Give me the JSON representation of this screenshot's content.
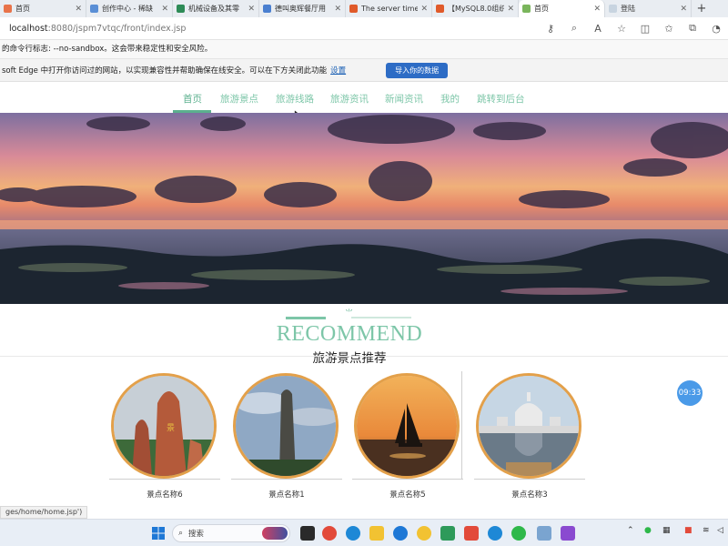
{
  "browser": {
    "tabs": [
      {
        "label": "首页",
        "favicon_color": "#e8734a",
        "active": false
      },
      {
        "label": "创作中心 - 稀缺",
        "favicon_color": "#5a8fd6",
        "active": false
      },
      {
        "label": "机械设备及其零",
        "favicon_color": "#2e8b57",
        "active": false
      },
      {
        "label": "德叫奥辉餐厅用",
        "favicon_color": "#4a7fd0",
        "active": false
      },
      {
        "label": "The server time",
        "favicon_color": "#e05a2a",
        "active": false
      },
      {
        "label": "【MySQL8.0组织",
        "favicon_color": "#e05a2a",
        "active": false
      },
      {
        "label": "首页",
        "favicon_color": "#7ab55c",
        "active": true
      },
      {
        "label": "登陆",
        "favicon_color": "#c8d4e0",
        "active": false
      }
    ],
    "url_host": "localhost",
    "url_path": ":8080/jspm7vtqc/front/index.jsp",
    "warning_text": "的命令行标志: --no-sandbox。这会带来稳定性和安全风险。",
    "edge_notice": "soft Edge 中打开你访问过的网站，以实现兼容性并帮助确保在线安全。可以在下方关闭此功能",
    "edge_settings_link": "设置",
    "edge_import_button": "导入你的数据",
    "status_url": "ges/home/home.jsp')"
  },
  "site": {
    "nav": [
      "首页",
      "旅游景点",
      "旅游线路",
      "旅游资讯",
      "新闻资讯",
      "我的",
      "跳转到后台"
    ],
    "recommend_title": "RECOMMEND",
    "recommend_subtitle": "旅游景点推荐",
    "spots": [
      {
        "caption": "景点名称6",
        "image": "red-rock-spire"
      },
      {
        "caption": "景点名称1",
        "image": "stone-pillar"
      },
      {
        "caption": "景点名称5",
        "image": "sailboat-sunset"
      },
      {
        "caption": "景点名称3",
        "image": "white-palace-reflection"
      }
    ],
    "time_badge": "09:33"
  },
  "taskbar": {
    "search_placeholder": "搜索"
  },
  "colors": {
    "accent_green": "#7dc6a8",
    "card_border": "#e3a04a",
    "badge_blue": "#4a9ae8"
  }
}
